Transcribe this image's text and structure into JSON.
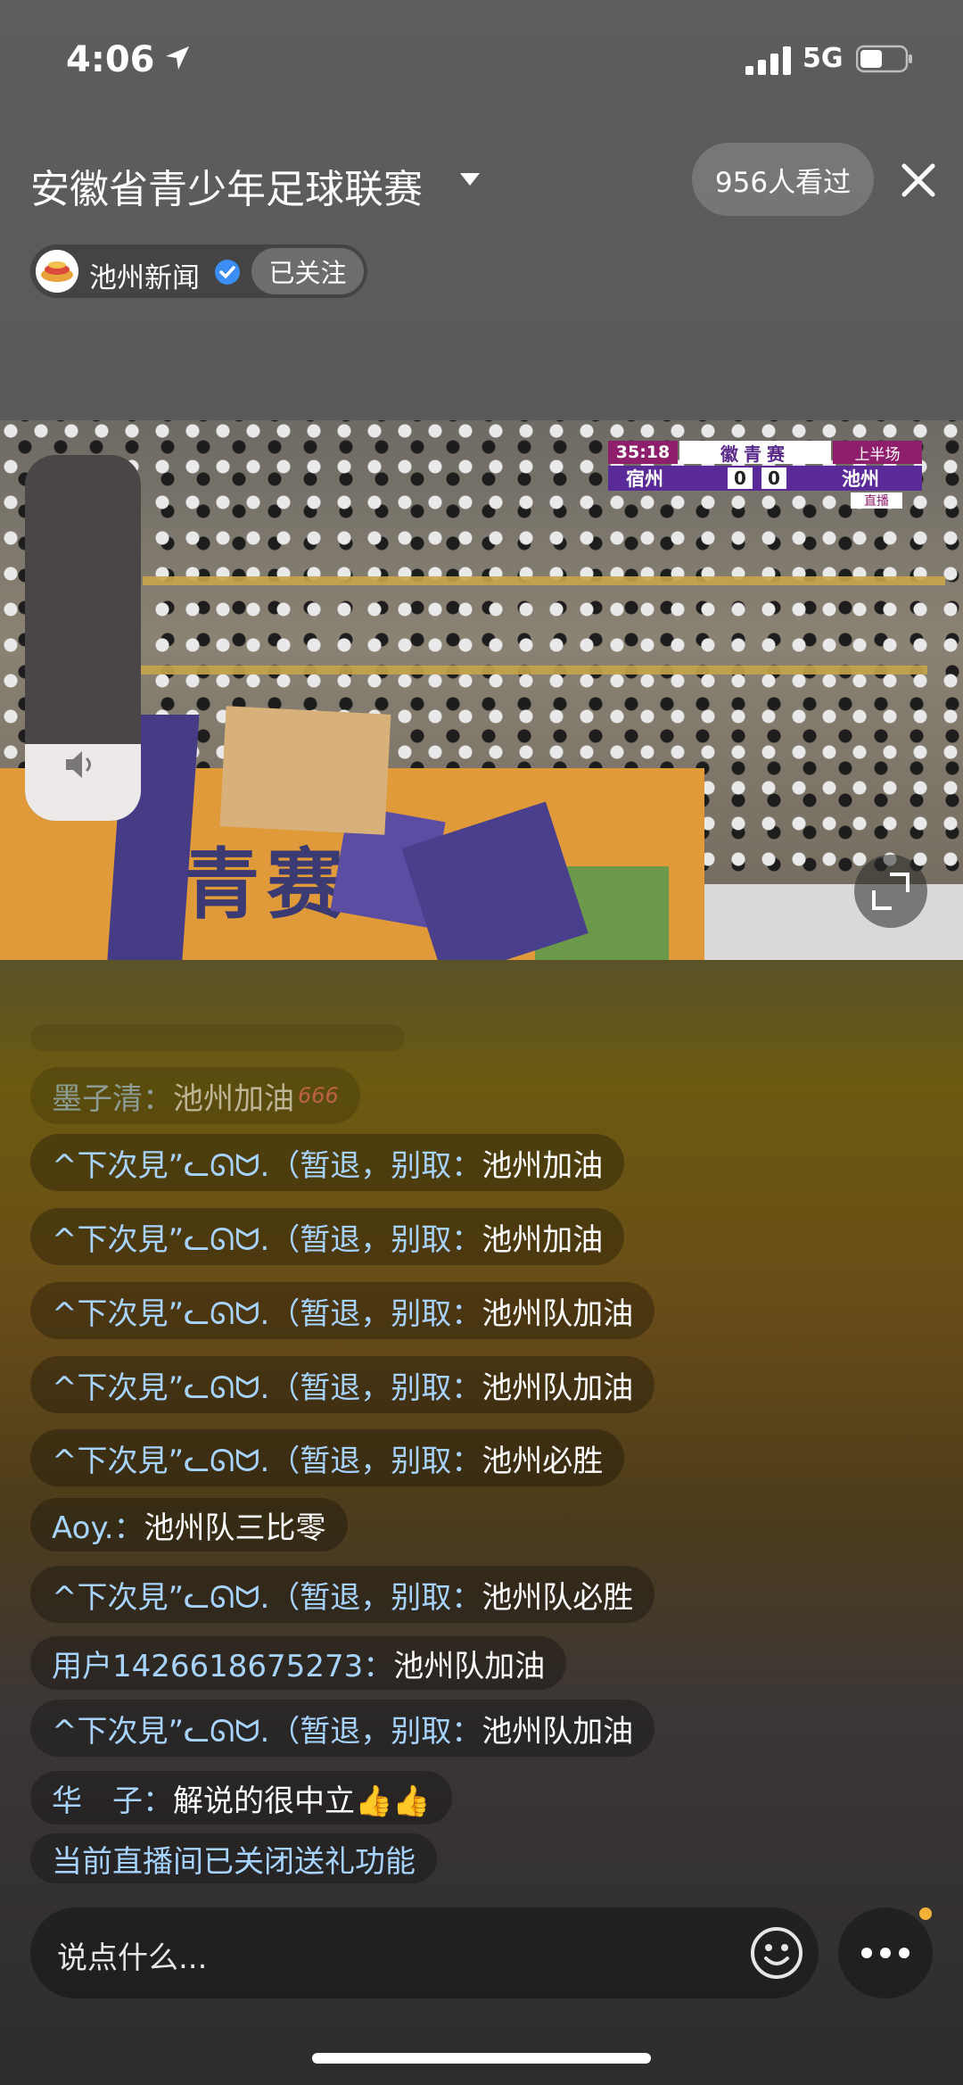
{
  "status_bar": {
    "time": "4:06",
    "network": "5G",
    "battery_level": 0.5
  },
  "header": {
    "title": "安徽省青少年足球联赛",
    "viewers": "956人看过",
    "channel_name": "池州新闻",
    "follow_label": "已关注"
  },
  "video": {
    "banner_text": "青赛",
    "scoreboard": {
      "clock": "35:18",
      "competition": "徽青赛",
      "period": "上半场",
      "home_team": "宿州",
      "home_score": "0",
      "away_score": "0",
      "away_team": "池州",
      "live_tag": "直播"
    },
    "volume_level": 0.21
  },
  "chat": {
    "messages": [
      {
        "user": "墨子清：",
        "text": "池州加油",
        "badge": "666"
      },
      {
        "user": "^下次見”ᓚᘏᗢ.（暂退，别取：",
        "text": "池州加油"
      },
      {
        "user": "^下次見”ᓚᘏᗢ.（暂退，别取：",
        "text": "池州加油"
      },
      {
        "user": "^下次見”ᓚᘏᗢ.（暂退，别取：",
        "text": "池州队加油"
      },
      {
        "user": "^下次見”ᓚᘏᗢ.（暂退，别取：",
        "text": "池州队加油"
      },
      {
        "user": "^下次見”ᓚᘏᗢ.（暂退，别取：",
        "text": "池州必胜"
      },
      {
        "user": "Aoy.：",
        "text": "池州队三比零"
      },
      {
        "user": "^下次見”ᓚᘏᗢ.（暂退，别取：",
        "text": "池州队必胜"
      },
      {
        "user": "用户1426618675273：",
        "text": "池州队加油"
      },
      {
        "user": "^下次見”ᓚᘏᗢ.（暂退，别取：",
        "text": "池州队加油"
      },
      {
        "user": "华　子：",
        "text": "解说的很中立👍👍"
      }
    ],
    "system_notice": "当前直播间已关闭送礼功能"
  },
  "input": {
    "placeholder": "说点什么..."
  },
  "colors": {
    "username": "#a7d3ff",
    "accent_dot": "#f3b13a",
    "scoreboard_purple": "#5a2a98",
    "scoreboard_magenta": "#8e1f6c"
  }
}
